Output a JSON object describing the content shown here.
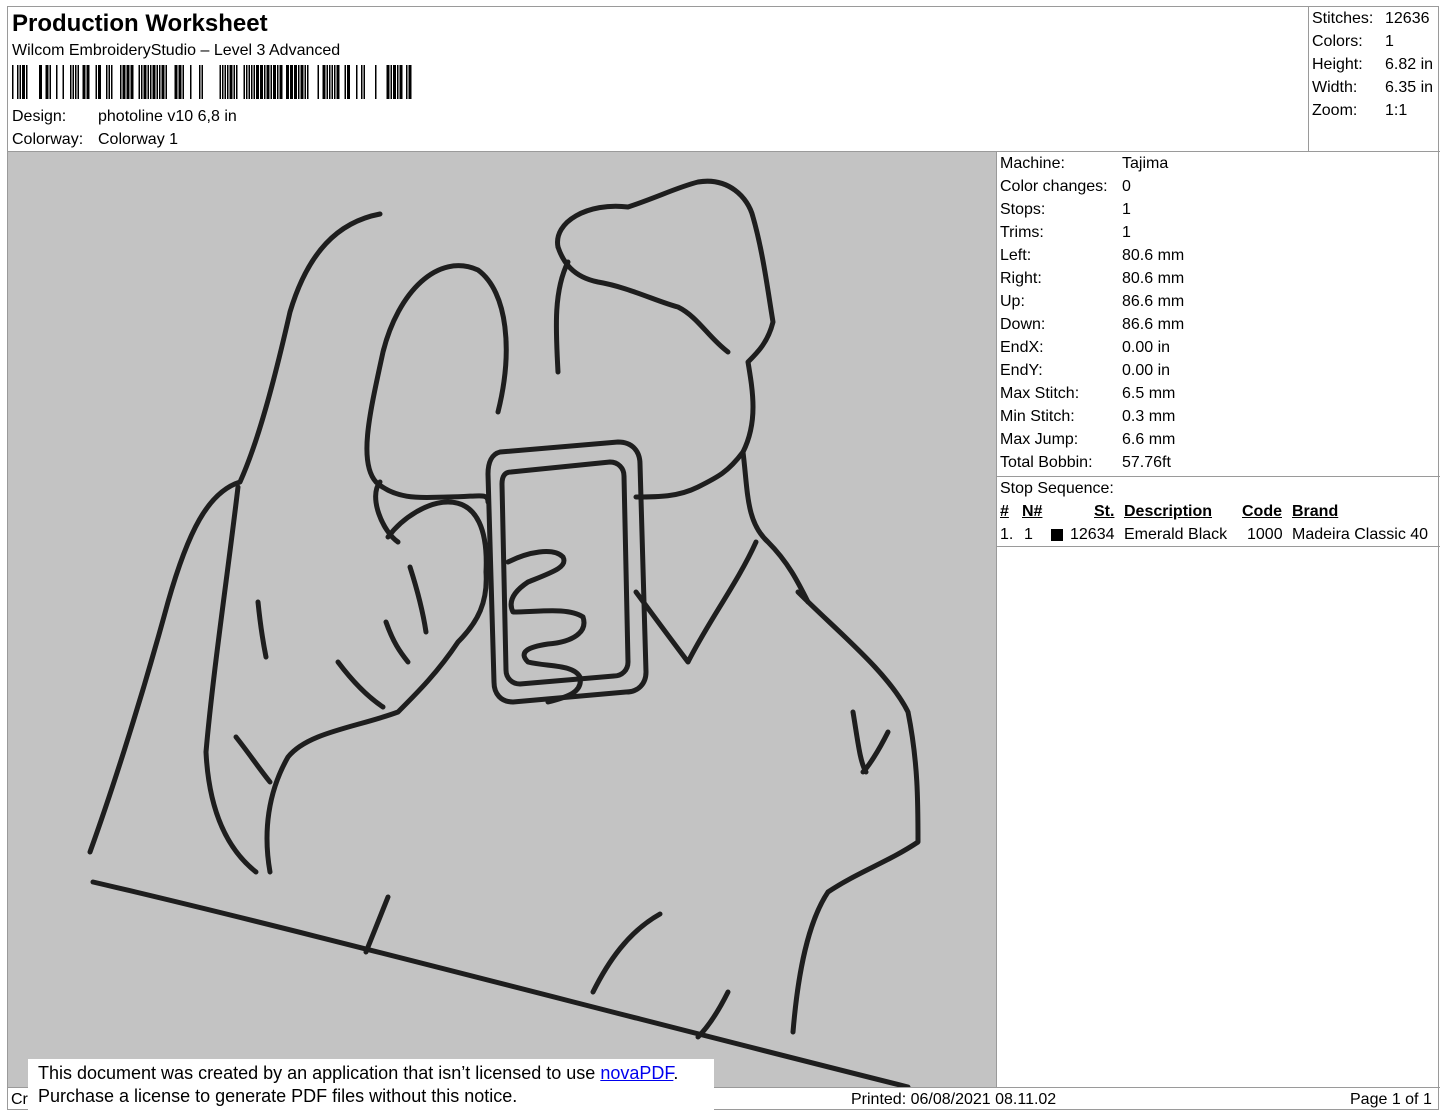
{
  "header": {
    "title": "Production Worksheet",
    "software": "Wilcom EmbroideryStudio – Level 3 Advanced",
    "design_label": "Design:",
    "design_value": "photoline v10 6,8 in",
    "colorway_label": "Colorway:",
    "colorway_value": "Colorway 1"
  },
  "stats": [
    {
      "label": "Stitches:",
      "value": "12636"
    },
    {
      "label": "Colors:",
      "value": "1"
    },
    {
      "label": "Height:",
      "value": "6.82 in"
    },
    {
      "label": "Width:",
      "value": "6.35 in"
    },
    {
      "label": "Zoom:",
      "value": "1:1"
    }
  ],
  "machine_info": [
    {
      "label": "Machine:",
      "value": "Tajima"
    },
    {
      "label": "Color changes:",
      "value": "0"
    },
    {
      "label": "Stops:",
      "value": "1"
    },
    {
      "label": "Trims:",
      "value": "1"
    },
    {
      "label": "Left:",
      "value": "80.6 mm"
    },
    {
      "label": "Right:",
      "value": "80.6 mm"
    },
    {
      "label": "Up:",
      "value": "86.6 mm"
    },
    {
      "label": "Down:",
      "value": "86.6 mm"
    },
    {
      "label": "EndX:",
      "value": "0.00 in"
    },
    {
      "label": "EndY:",
      "value": "0.00 in"
    },
    {
      "label": "Max Stitch:",
      "value": "6.5 mm"
    },
    {
      "label": "Min Stitch:",
      "value": "0.3 mm"
    },
    {
      "label": "Max Jump:",
      "value": "6.6 mm"
    },
    {
      "label": "Total Bobbin:",
      "value": "57.76ft"
    }
  ],
  "stop_sequence": {
    "title": "Stop Sequence:",
    "columns": [
      "#",
      "N#",
      "St.",
      "Description",
      "Code",
      "Brand"
    ],
    "rows": [
      {
        "index": "1.",
        "needle": "1",
        "color": "#000000",
        "stitches": "12634",
        "description": "Emerald Black",
        "code": "1000",
        "brand": "Madeira Classic 40"
      }
    ]
  },
  "footer": {
    "created": "Cr",
    "printed": "Printed: 06/08/2021 08.11.02",
    "page": "Page 1 of 1"
  },
  "notice": {
    "line1_prefix": "This document was created by an application that isn’t licensed to use ",
    "link": "novaPDF",
    "line1_suffix": ".",
    "line2": "Purchase a license to generate PDF files without this notice."
  },
  "colors": {
    "preview_background": "#c3c3c3",
    "thread": "#1e1e1e"
  }
}
